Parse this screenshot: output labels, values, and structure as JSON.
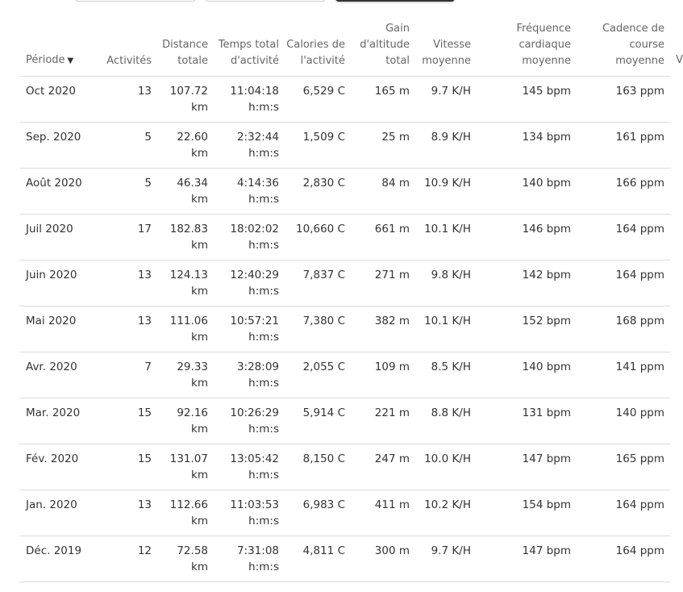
{
  "headers": {
    "period": "Période",
    "activities": "Activités",
    "distance": "Distance totale",
    "time": "Temps total d'activité",
    "calories": "Calories de l'activité",
    "elev": "Gain d'altitude total",
    "speed": "Vitesse moyenne",
    "hr": "Fréquence cardiaque moyenne",
    "cadence": "Cadence de course moyenne",
    "extra_partial": "V",
    "sort_icon": "▼"
  },
  "rows": [
    {
      "period": "Oct 2020",
      "activities": "13",
      "distance": "107.72",
      "distance_unit": "km",
      "time": "11:04:18",
      "time_unit": "h:m:s",
      "calories": "6,529 C",
      "elev": "165 m",
      "speed": "9.7 K/H",
      "hr": "145 bpm",
      "cadence": "163 ppm"
    },
    {
      "period": "Sep. 2020",
      "activities": "5",
      "distance": "22.60",
      "distance_unit": "km",
      "time": "2:32:44",
      "time_unit": "h:m:s",
      "calories": "1,509 C",
      "elev": "25 m",
      "speed": "8.9 K/H",
      "hr": "134 bpm",
      "cadence": "161 ppm"
    },
    {
      "period": "Août 2020",
      "activities": "5",
      "distance": "46.34",
      "distance_unit": "km",
      "time": "4:14:36",
      "time_unit": "h:m:s",
      "calories": "2,830 C",
      "elev": "84 m",
      "speed": "10.9 K/H",
      "hr": "140 bpm",
      "cadence": "166 ppm"
    },
    {
      "period": "Juil 2020",
      "activities": "17",
      "distance": "182.83",
      "distance_unit": "km",
      "time": "18:02:02",
      "time_unit": "h:m:s",
      "calories": "10,660 C",
      "elev": "661 m",
      "speed": "10.1 K/H",
      "hr": "146 bpm",
      "cadence": "164 ppm"
    },
    {
      "period": "Juin 2020",
      "activities": "13",
      "distance": "124.13",
      "distance_unit": "km",
      "time": "12:40:29",
      "time_unit": "h:m:s",
      "calories": "7,837 C",
      "elev": "271 m",
      "speed": "9.8 K/H",
      "hr": "142 bpm",
      "cadence": "164 ppm"
    },
    {
      "period": "Mai 2020",
      "activities": "13",
      "distance": "111.06",
      "distance_unit": "km",
      "time": "10:57:21",
      "time_unit": "h:m:s",
      "calories": "7,380 C",
      "elev": "382 m",
      "speed": "10.1 K/H",
      "hr": "152 bpm",
      "cadence": "168 ppm"
    },
    {
      "period": "Avr. 2020",
      "activities": "7",
      "distance": "29.33",
      "distance_unit": "km",
      "time": "3:28:09",
      "time_unit": "h:m:s",
      "calories": "2,055 C",
      "elev": "109 m",
      "speed": "8.5 K/H",
      "hr": "140 bpm",
      "cadence": "141 ppm"
    },
    {
      "period": "Mar. 2020",
      "activities": "15",
      "distance": "92.16",
      "distance_unit": "km",
      "time": "10:26:29",
      "time_unit": "h:m:s",
      "calories": "5,914 C",
      "elev": "221 m",
      "speed": "8.8 K/H",
      "hr": "131 bpm",
      "cadence": "140 ppm"
    },
    {
      "period": "Fév. 2020",
      "activities": "15",
      "distance": "131.07",
      "distance_unit": "km",
      "time": "13:05:42",
      "time_unit": "h:m:s",
      "calories": "8,150 C",
      "elev": "247 m",
      "speed": "10.0 K/H",
      "hr": "147 bpm",
      "cadence": "165 ppm"
    },
    {
      "period": "Jan. 2020",
      "activities": "13",
      "distance": "112.66",
      "distance_unit": "km",
      "time": "11:03:53",
      "time_unit": "h:m:s",
      "calories": "6,983 C",
      "elev": "411 m",
      "speed": "10.2 K/H",
      "hr": "154 bpm",
      "cadence": "164 ppm"
    },
    {
      "period": "Déc. 2019",
      "activities": "12",
      "distance": "72.58",
      "distance_unit": "km",
      "time": "7:31:08",
      "time_unit": "h:m:s",
      "calories": "4,811 C",
      "elev": "300 m",
      "speed": "9.7 K/H",
      "hr": "147 bpm",
      "cadence": "164 ppm"
    }
  ]
}
